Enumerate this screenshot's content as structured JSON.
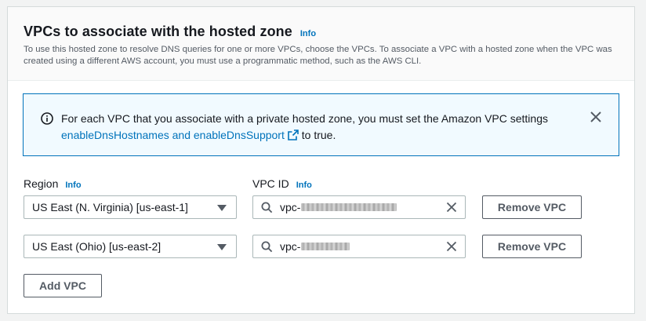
{
  "section": {
    "title": "VPCs to associate with the hosted zone",
    "info_label": "Info",
    "description": "To use this hosted zone to resolve DNS queries for one or more VPCs, choose the VPCs. To associate a VPC with a hosted zone when the VPC was created using a different AWS account, you must use a programmatic method, such as the AWS CLI."
  },
  "alert": {
    "text_before": "For each VPC that you associate with a private hosted zone, you must set the Amazon VPC settings",
    "link_text": "enableDnsHostnames and enableDnsSupport",
    "text_after": "to true.",
    "type": "info",
    "icon": "info-circle-icon",
    "accent_color": "#0073bb"
  },
  "labels": {
    "region": "Region",
    "vpc_id": "VPC ID",
    "info": "Info"
  },
  "rows": [
    {
      "region": "US East (N. Virginia) [us-east-1]",
      "vpc_prefix": "vpc-",
      "remove_label": "Remove VPC"
    },
    {
      "region": "US East (Ohio) [us-east-2]",
      "vpc_prefix": "vpc-",
      "remove_label": "Remove VPC"
    }
  ],
  "add_vpc_label": "Add VPC",
  "colors": {
    "link": "#0073bb",
    "alert_bg": "#f1faff",
    "border": "#aab7b8"
  }
}
